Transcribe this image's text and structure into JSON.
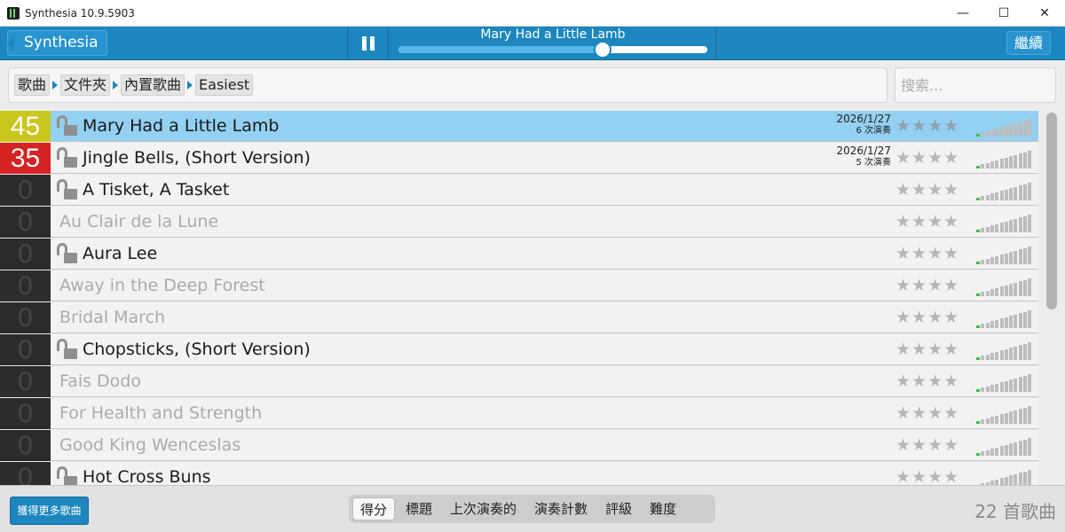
{
  "window": {
    "title": "Synthesia 10.9.5903",
    "minimize": "—",
    "maximize": "☐",
    "close": "✕"
  },
  "header": {
    "back_label": "Synthesia",
    "now_playing": "Mary Had a Little Lamb",
    "playback_progress": 0.66,
    "continue_label": "繼續"
  },
  "breadcrumb": [
    "歌曲",
    "文件夾",
    "內置歌曲",
    "Easiest"
  ],
  "search": {
    "placeholder": "搜索..."
  },
  "songs": [
    {
      "score": "45",
      "score_style": "gold",
      "title": "Mary Had a Little Lamb",
      "unlocked": true,
      "date": "2026/1/27",
      "plays": "6 次演奏",
      "selected": true
    },
    {
      "score": "35",
      "score_style": "red",
      "title": "Jingle Bells, (Short Version)",
      "unlocked": true,
      "date": "2026/1/27",
      "plays": "5 次演奏"
    },
    {
      "score": "0",
      "score_style": "none",
      "title": "A Tisket, A Tasket",
      "unlocked": true
    },
    {
      "score": "0",
      "score_style": "none",
      "title": "Au Clair de la Lune",
      "unlocked": false
    },
    {
      "score": "0",
      "score_style": "none",
      "title": "Aura Lee",
      "unlocked": true
    },
    {
      "score": "0",
      "score_style": "none",
      "title": "Away in the Deep Forest",
      "unlocked": false
    },
    {
      "score": "0",
      "score_style": "none",
      "title": "Bridal March",
      "unlocked": false
    },
    {
      "score": "0",
      "score_style": "none",
      "title": "Chopsticks, (Short Version)",
      "unlocked": true
    },
    {
      "score": "0",
      "score_style": "none",
      "title": "Fais Dodo",
      "unlocked": false
    },
    {
      "score": "0",
      "score_style": "none",
      "title": "For Health and Strength",
      "unlocked": false
    },
    {
      "score": "0",
      "score_style": "none",
      "title": "Good King Wenceslas",
      "unlocked": false
    },
    {
      "score": "0",
      "score_style": "none",
      "title": "Hot Cross Buns",
      "unlocked": true
    }
  ],
  "rating_stars": "★★★★",
  "difficulty_level": 1,
  "footer": {
    "more_songs_label": "獲得更多歌曲",
    "sort_tabs": [
      "得分",
      "標題",
      "上次演奏的",
      "演奏計數",
      "評級",
      "難度"
    ],
    "active_sort": 0,
    "song_total": "22 首歌曲"
  },
  "colors": {
    "header_blue": "#1d86bf",
    "selected_row": "#93d0f1",
    "score_gold": "#c8c61e",
    "score_red": "#d62222",
    "difficulty_green": "#3fbf3f"
  },
  "icons": {
    "app": "synthesia-app-icon",
    "pause": "pause-icon",
    "lock": "unlocked-padlock-icon",
    "difficulty": "difficulty-bars-icon"
  }
}
